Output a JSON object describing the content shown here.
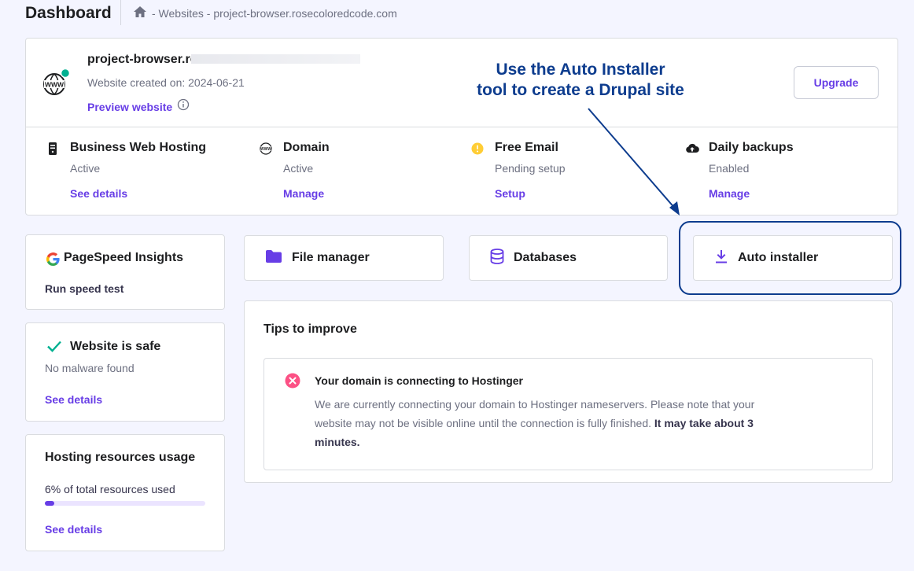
{
  "header": {
    "title": "Dashboard",
    "breadcrumb": "- Websites - project-browser.rosecoloredcode.com"
  },
  "site": {
    "name": "project-browser.ro",
    "created": "Website created on: 2024-06-21",
    "preview_label": "Preview website",
    "upgrade_label": "Upgrade",
    "status_color": "#00b090"
  },
  "features": [
    {
      "name": "Business Web Hosting",
      "status": "Active",
      "link": "See details",
      "icon": "server-icon"
    },
    {
      "name": "Domain",
      "status": "Active",
      "link": "Manage",
      "icon": "www-icon"
    },
    {
      "name": "Free Email",
      "status": "Pending setup",
      "link": "Setup",
      "icon": "warning-icon"
    },
    {
      "name": "Daily backups",
      "status": "Enabled",
      "link": "Manage",
      "icon": "cloud-upload-icon"
    }
  ],
  "sidebar": {
    "pagespeed": {
      "title": "PageSpeed Insights",
      "action": "Run speed test"
    },
    "safety": {
      "title": "Website is safe",
      "status": "No malware found",
      "link": "See details"
    },
    "resources": {
      "title": "Hosting resources usage",
      "usage_text": "6% of total resources used",
      "usage_fraction": 0.06,
      "link": "See details"
    }
  },
  "tools": {
    "file_manager": "File manager",
    "databases": "Databases",
    "auto_installer": "Auto installer"
  },
  "tips": {
    "title": "Tips to improve",
    "alert_title": "Your domain is connecting to Hostinger",
    "alert_text": "We are currently connecting your domain to Hostinger nameservers. Please note that your website may not be visible online until the connection is fully finished.",
    "alert_emphasis": "It may take about 3 minutes."
  },
  "annotation": {
    "line1": "Use the Auto Installer",
    "line2": "tool to create a Drupal site"
  },
  "colors": {
    "accent": "#673de6",
    "annotation": "#0d3c8e",
    "error": "#fc5185",
    "warning": "#ffcd35"
  }
}
